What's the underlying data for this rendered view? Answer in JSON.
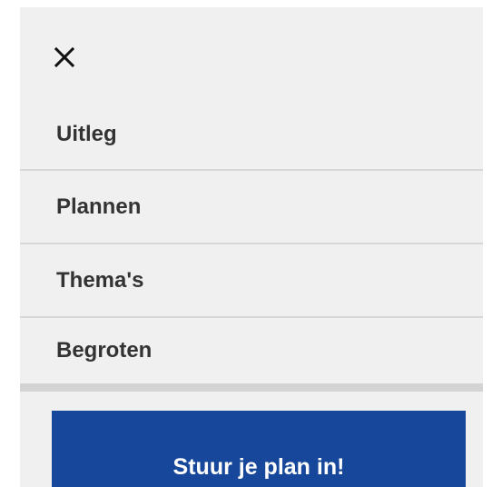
{
  "menu": {
    "close_icon": "close-icon",
    "items": [
      {
        "label": "Uitleg"
      },
      {
        "label": "Plannen"
      },
      {
        "label": "Thema's"
      },
      {
        "label": "Begroten"
      }
    ]
  },
  "cta": {
    "label": "Stuur je plan in!",
    "color": "#16479a"
  }
}
